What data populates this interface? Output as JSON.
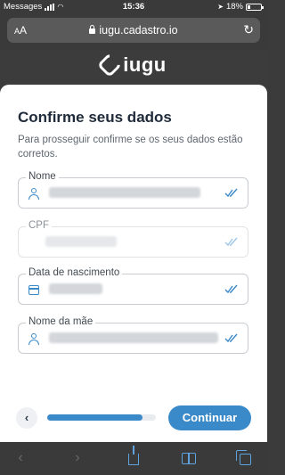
{
  "status_bar": {
    "carrier": "Messages",
    "time": "15:36",
    "battery": "18%"
  },
  "browser": {
    "text_size": "AA",
    "url": "iugu.cadastro.io"
  },
  "brand": {
    "name": "iugu"
  },
  "form": {
    "title": "Confirme seus dados",
    "subtitle": "Para prosseguir confirme se os seus dados estão corretos.",
    "fields": [
      {
        "label": "Nome",
        "icon": "person-icon",
        "editable": true
      },
      {
        "label": "CPF",
        "icon": "none",
        "editable": false
      },
      {
        "label": "Data de nascimento",
        "icon": "calendar-icon",
        "editable": true
      },
      {
        "label": "Nome da mãe",
        "icon": "person-icon",
        "editable": true
      }
    ]
  },
  "navigation": {
    "back_label": "‹",
    "continue_label": "Continuar",
    "progress": 0.88
  },
  "colors": {
    "accent": "#3a89c9",
    "chrome": "#3a3a3a"
  }
}
